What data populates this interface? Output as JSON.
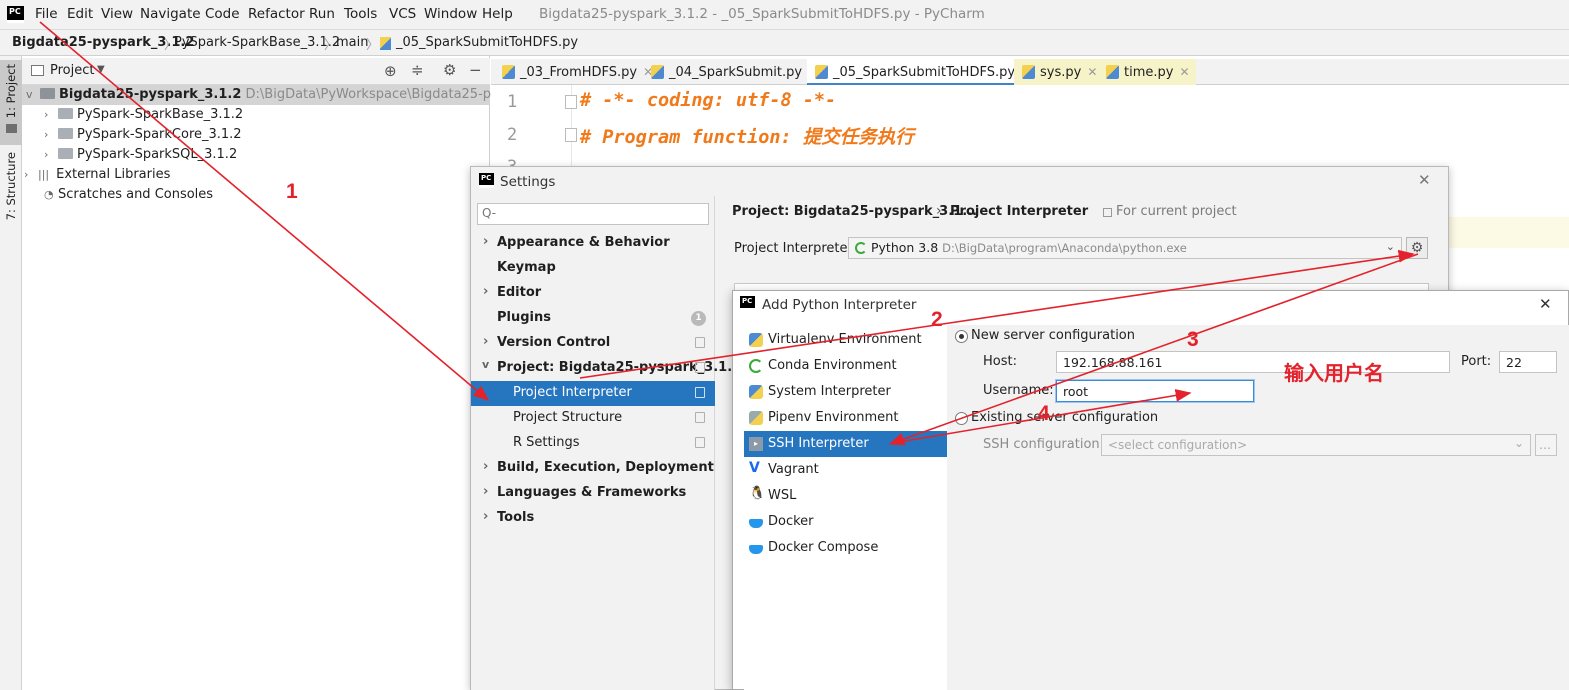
{
  "app": {
    "menu": [
      "File",
      "Edit",
      "View",
      "Navigate",
      "Code",
      "Refactor",
      "Run",
      "Tools",
      "VCS",
      "Window",
      "Help"
    ],
    "menu_mnemonic_first_letter": true,
    "window_title": "Bigdata25-pyspark_3.1.2 - _05_SparkSubmitToHDFS.py - PyCharm",
    "logo": "PC"
  },
  "breadcrumb": [
    "Bigdata25-pyspark_3.1.2",
    "PySpark-SparkBase_3.1.2",
    "main",
    "_05_SparkSubmitToHDFS.py"
  ],
  "left_toolstrip": {
    "project_tab": "1: Project",
    "structure_tab": "7: Structure"
  },
  "project_panel": {
    "title": "Project",
    "root": {
      "name": "Bigdata25-pyspark_3.1.2",
      "path": "D:\\BigData\\PyWorkspace\\Bigdata25-pyspark_3"
    },
    "children": [
      "PySpark-SparkBase_3.1.2",
      "PySpark-SparkCore_3.1.2",
      "PySpark-SparkSQL_3.1.2"
    ],
    "external": "External Libraries",
    "scratches": "Scratches and Consoles"
  },
  "editor": {
    "tabs": [
      "_03_FromHDFS.py",
      "_04_SparkSubmit.py",
      "_05_SparkSubmitToHDFS.py",
      "sys.py",
      "time.py"
    ],
    "line_numbers": [
      "1",
      "2",
      "3"
    ],
    "lines": [
      "# -*- coding: utf-8 -*-",
      "# Program function:  提交任务执行"
    ]
  },
  "settings": {
    "title": "Settings",
    "search_placeholder": "Q-",
    "nav": [
      {
        "label": "Appearance & Behavior",
        "bold": true,
        "chevron": "right"
      },
      {
        "label": "Keymap",
        "bold": true
      },
      {
        "label": "Editor",
        "bold": true,
        "chevron": "right"
      },
      {
        "label": "Plugins",
        "bold": true,
        "badge": "1"
      },
      {
        "label": "Version Control",
        "bold": true,
        "chevron": "right"
      },
      {
        "label": "Project: Bigdata25-pyspark_3.1...",
        "bold": true,
        "chevron": "down"
      },
      {
        "label": "Project Interpreter",
        "selected": true
      },
      {
        "label": "Project Structure"
      },
      {
        "label": "R Settings"
      },
      {
        "label": "Build, Execution, Deployment",
        "bold": true,
        "chevron": "right"
      },
      {
        "label": "Languages & Frameworks",
        "bold": true,
        "chevron": "right"
      },
      {
        "label": "Tools",
        "bold": true,
        "chevron": "right"
      }
    ],
    "header_project": "Project: Bigdata25-pyspark_3.1...",
    "header_arrow": "›",
    "header_page": "Project Interpreter",
    "header_hint": "For current project",
    "interpreter_label": "Project Interpreter:",
    "interpreter_name": "Python 3.8",
    "interpreter_path": "D:\\BigData\\program\\Anaconda\\python.exe"
  },
  "add_python": {
    "title": "Add Python Interpreter",
    "items": [
      "Virtualenv Environment",
      "Conda Environment",
      "System Interpreter",
      "Pipenv Environment",
      "SSH Interpreter",
      "Vagrant",
      "WSL",
      "Docker",
      "Docker Compose"
    ],
    "selected": "SSH Interpreter",
    "new_server": "New server configuration",
    "host_label": "Host:",
    "host_value": "192.168.88.161",
    "port_label": "Port:",
    "port_value": "22",
    "username_label": "Username:",
    "username_value": "root",
    "existing": "Existing server configuration",
    "ssh_config_label": "SSH configuration:",
    "ssh_config_placeholder": "<select configuration>",
    "ellipsis": "..."
  },
  "annotations": {
    "n1": "1",
    "n2": "2",
    "n3": "3",
    "n4": "4",
    "note": "输入用户名",
    "color": "#e3222b"
  },
  "colors": {
    "selection": "#2675bf",
    "code": "#f07a1a"
  }
}
